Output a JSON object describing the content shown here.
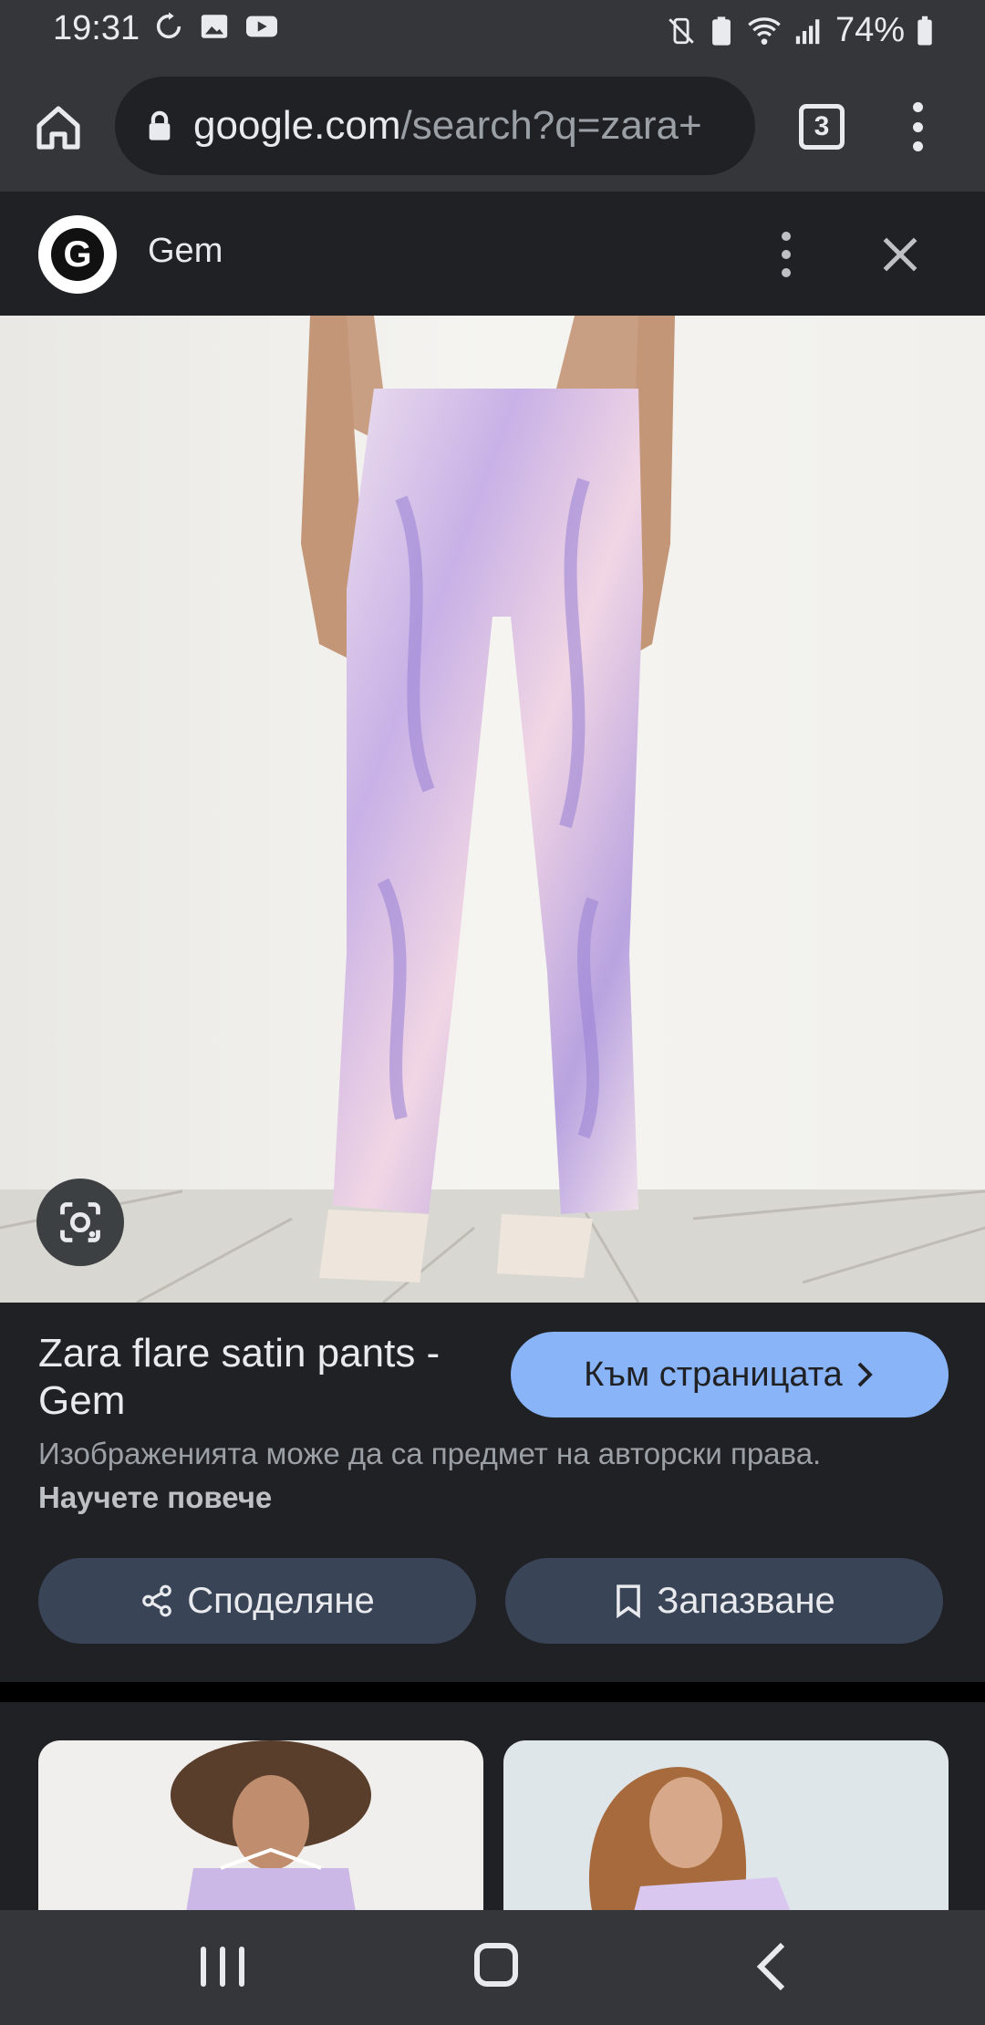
{
  "status_bar": {
    "time": "19:31",
    "battery": "74%"
  },
  "browser": {
    "url_host": "google.com",
    "url_rest": "/search?q=zara+",
    "tab_count": "3"
  },
  "site": {
    "name": "Gem",
    "logo_letter": "G"
  },
  "result": {
    "title": "Zara flare satin pants - Gem",
    "visit_label": "Към страницата",
    "copyright_text": "Изображенията може да са предмет на авторски права.",
    "learn_more": "Научете повече",
    "share_label": "Споделяне",
    "save_label": "Запазване"
  },
  "icons": {
    "home": "home-icon",
    "lock": "lock-icon",
    "tabs": "tabs-icon",
    "menu": "more-vert-icon",
    "close": "close-icon",
    "lens": "google-lens-icon",
    "share": "share-icon",
    "save": "bookmark-icon",
    "chevron": "chevron-right-icon"
  },
  "colors": {
    "accent": "#8ab4f8",
    "pill": "#394457",
    "background": "#202124"
  }
}
